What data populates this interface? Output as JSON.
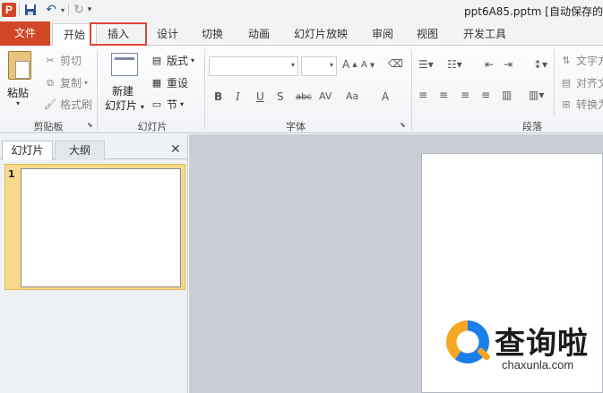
{
  "titlebar": {
    "app_icon": "P",
    "document_title": "ppt6A85.pptm [自动保存的",
    "icons": [
      "powerpoint-icon",
      "save-icon",
      "undo-icon",
      "redo-icon",
      "customize-qat-icon"
    ]
  },
  "tabs": {
    "file": "文件",
    "home": "开始",
    "insert": "插入",
    "design": "设计",
    "transitions": "切换",
    "animations": "动画",
    "slideshow": "幻灯片放映",
    "review": "审阅",
    "view": "视图",
    "developer": "开发工具"
  },
  "ribbon": {
    "clipboard": {
      "paste": "粘贴",
      "cut": "剪切",
      "copy": "复制",
      "format_painter": "格式刷",
      "group_label": "剪贴板"
    },
    "slides": {
      "new_slide_line1": "新建",
      "new_slide_line2": "幻灯片",
      "layout": "版式",
      "reset": "重设",
      "section": "节",
      "group_label": "幻灯片"
    },
    "font": {
      "group_label": "字体",
      "buttons": [
        "B",
        "I",
        "U",
        "S",
        "abc",
        "AV",
        "Aa",
        "A"
      ]
    },
    "paragraph": {
      "group_label": "段落",
      "text_direction": "文字方",
      "align_text": "对齐文",
      "convert": "转换为"
    }
  },
  "left_panel": {
    "tab_slides": "幻灯片",
    "tab_outline": "大纲",
    "close": "✕",
    "slide_number": "1"
  },
  "watermark": {
    "text": "查询啦",
    "url": "chaxunla.com"
  },
  "colors": {
    "file_tab": "#d24726",
    "highlight_box": "#e0453c",
    "selected_slide": "#f7d98c",
    "canvas_bg": "#c9cdd4"
  }
}
